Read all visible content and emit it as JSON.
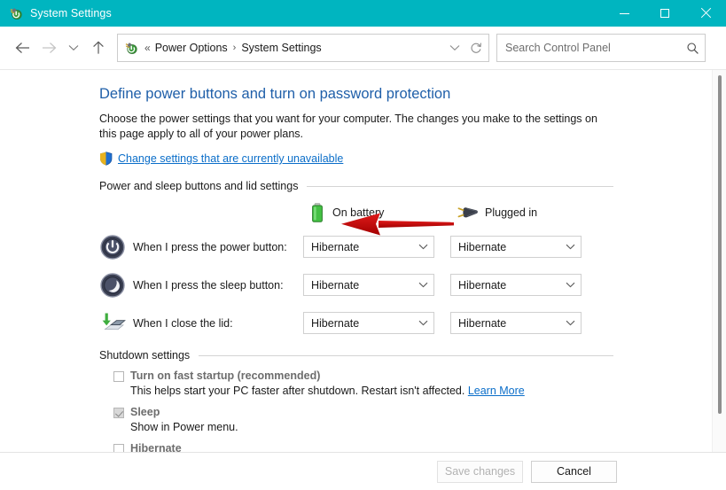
{
  "window": {
    "title": "System Settings",
    "icon": "control-panel-power-icon",
    "accent_color": "#00b5c0",
    "controls": {
      "minimize": "minimize",
      "maximize": "maximize",
      "close": "close"
    }
  },
  "nav": {
    "back": "back",
    "forward": "forward",
    "recent": "recent-locations",
    "up": "up-one-level",
    "breadcrumb": {
      "overflow": "«",
      "items": [
        "Power Options",
        "System Settings"
      ],
      "separator": "›"
    },
    "history_dropdown": "previous-locations",
    "refresh": "refresh"
  },
  "search": {
    "placeholder": "Search Control Panel",
    "value": "",
    "icon": "search-icon"
  },
  "main": {
    "heading": "Define power buttons and turn on password protection",
    "intro": "Choose the power settings that you want for your computer. The changes you make to the settings on this page apply to all of your power plans.",
    "uac_link": "Change settings that are currently unavailable",
    "uac_icon": "shield-icon",
    "power_section": {
      "title": "Power and sleep buttons and lid settings",
      "columns": [
        {
          "label": "On battery",
          "icon": "battery-icon"
        },
        {
          "label": "Plugged in",
          "icon": "power-plug-icon"
        }
      ],
      "rows": [
        {
          "icon": "power-button-icon",
          "label": "When I press the power button:",
          "on_battery": "Hibernate",
          "plugged_in": "Hibernate"
        },
        {
          "icon": "sleep-button-icon",
          "label": "When I press the sleep button:",
          "on_battery": "Hibernate",
          "plugged_in": "Hibernate"
        },
        {
          "icon": "laptop-lid-icon",
          "label": "When I close the lid:",
          "on_battery": "Hibernate",
          "plugged_in": "Hibernate"
        }
      ]
    },
    "shutdown_section": {
      "title": "Shutdown settings",
      "items": [
        {
          "label": "Turn on fast startup (recommended)",
          "checked": false,
          "description": "This helps start your PC faster after shutdown. Restart isn't affected.",
          "link": "Learn More"
        },
        {
          "label": "Sleep",
          "checked": true,
          "description": "Show in Power menu.",
          "link": ""
        },
        {
          "label": "Hibernate",
          "checked": false,
          "description": "",
          "link": ""
        }
      ]
    }
  },
  "footer": {
    "save_label": "Save changes",
    "save_enabled": false,
    "cancel_label": "Cancel"
  },
  "annotation": {
    "type": "red-arrow",
    "color": "#cc0000",
    "points_to": "uac_link"
  }
}
